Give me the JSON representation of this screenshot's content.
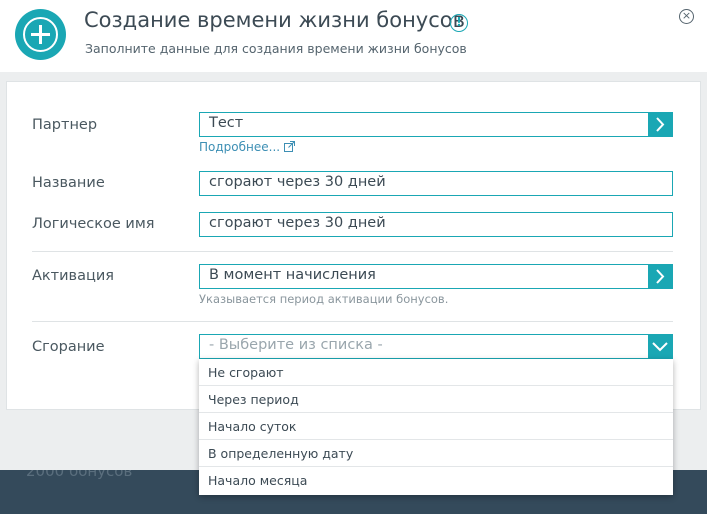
{
  "background": {
    "text": "2000 бонусов"
  },
  "header": {
    "title": "Создание времени жизни бонусов",
    "subtitle": "Заполните данные для создания времени жизни бонусов"
  },
  "form": {
    "partner": {
      "label": "Партнер",
      "value": "Тест",
      "link": "Подробнее..."
    },
    "name": {
      "label": "Название",
      "value": "сгорают через 30 дней"
    },
    "logical_name": {
      "label": "Логическое имя",
      "value": "сгорают через 30 дней"
    },
    "activation": {
      "label": "Активация",
      "value": "В момент начисления",
      "hint": "Указывается период активации бонусов."
    },
    "expiry": {
      "label": "Сгорание",
      "placeholder": "- Выберите из списка -"
    }
  },
  "dropdown": {
    "options": [
      "Не сгорают",
      "Через период",
      "Начало суток",
      "В определенную дату",
      "Начало месяца"
    ]
  },
  "colors": {
    "accent": "#1aa7b4",
    "link": "#3d8fb4"
  }
}
